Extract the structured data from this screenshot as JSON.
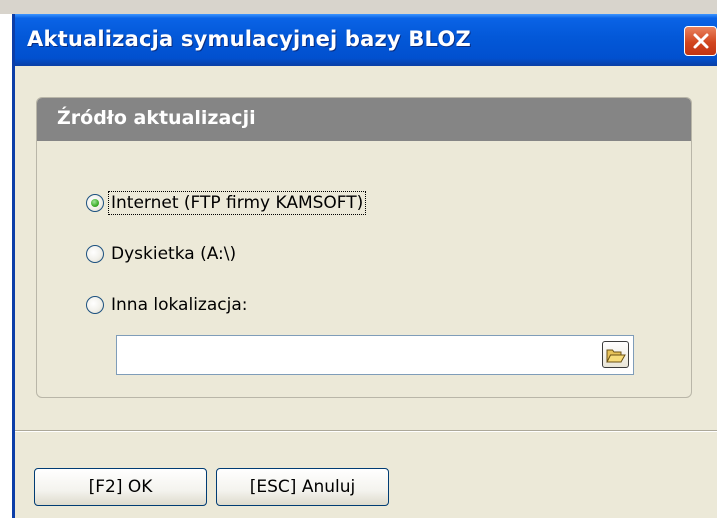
{
  "window": {
    "title": "Aktualizacja symulacyjnej bazy BLOZ",
    "close_icon": "close-icon",
    "colors": {
      "titlebar": "#0358d8",
      "close_button": "#d2461f",
      "body": "#ece9d8",
      "panel_header": "#858585"
    }
  },
  "panel": {
    "title": "Źródło aktualizacji",
    "options": [
      {
        "label": "Internet (FTP firmy KAMSOFT)",
        "selected": true
      },
      {
        "label": "Dyskietka (A:\\)",
        "selected": false
      },
      {
        "label": "Inna lokalizacja:",
        "selected": false
      }
    ],
    "location_input": {
      "value": "",
      "placeholder": ""
    },
    "browse_icon": "folder-open-icon"
  },
  "buttons": {
    "ok_label": "[F2] OK",
    "cancel_label": "[ESC] Anuluj"
  }
}
